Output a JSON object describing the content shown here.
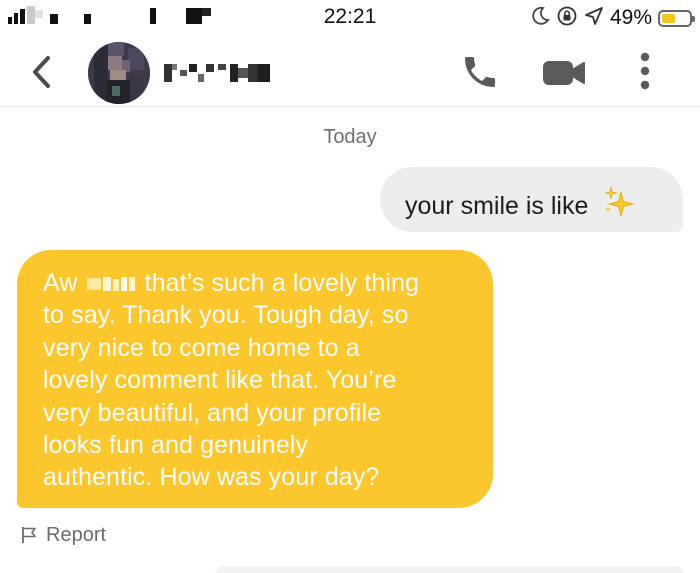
{
  "status_bar": {
    "time": "22:21",
    "battery_percent": "49%",
    "battery_level": 0.49,
    "icons": [
      "signal-icon",
      "moon-icon",
      "rotation-lock-icon",
      "location-arrow-icon",
      "battery-icon"
    ],
    "accent": "#f5c518"
  },
  "header": {
    "back_icon": "chevron-left-icon",
    "call_icon": "phone-icon",
    "video_icon": "video-camera-icon",
    "more_icon": "vertical-dots-icon"
  },
  "chat": {
    "date_separator": "Today",
    "outgoing": {
      "text": "your smile is like",
      "emoji_icon": "sparkles-icon"
    },
    "incoming": {
      "line1_pre": "Aw",
      "line1_post": "that’s such a lovely thing",
      "line2": "to say. Thank you. Tough day, so",
      "line3": "very nice to come home to a",
      "line4": "lovely comment like that. You’re",
      "line5": "very beautiful, and your profile",
      "line6": "looks fun and genuinely",
      "line7": "authentic. How was your day?",
      "bubble_color": "#fcc72c"
    },
    "report_label": "Report",
    "report_icon": "flag-icon"
  }
}
